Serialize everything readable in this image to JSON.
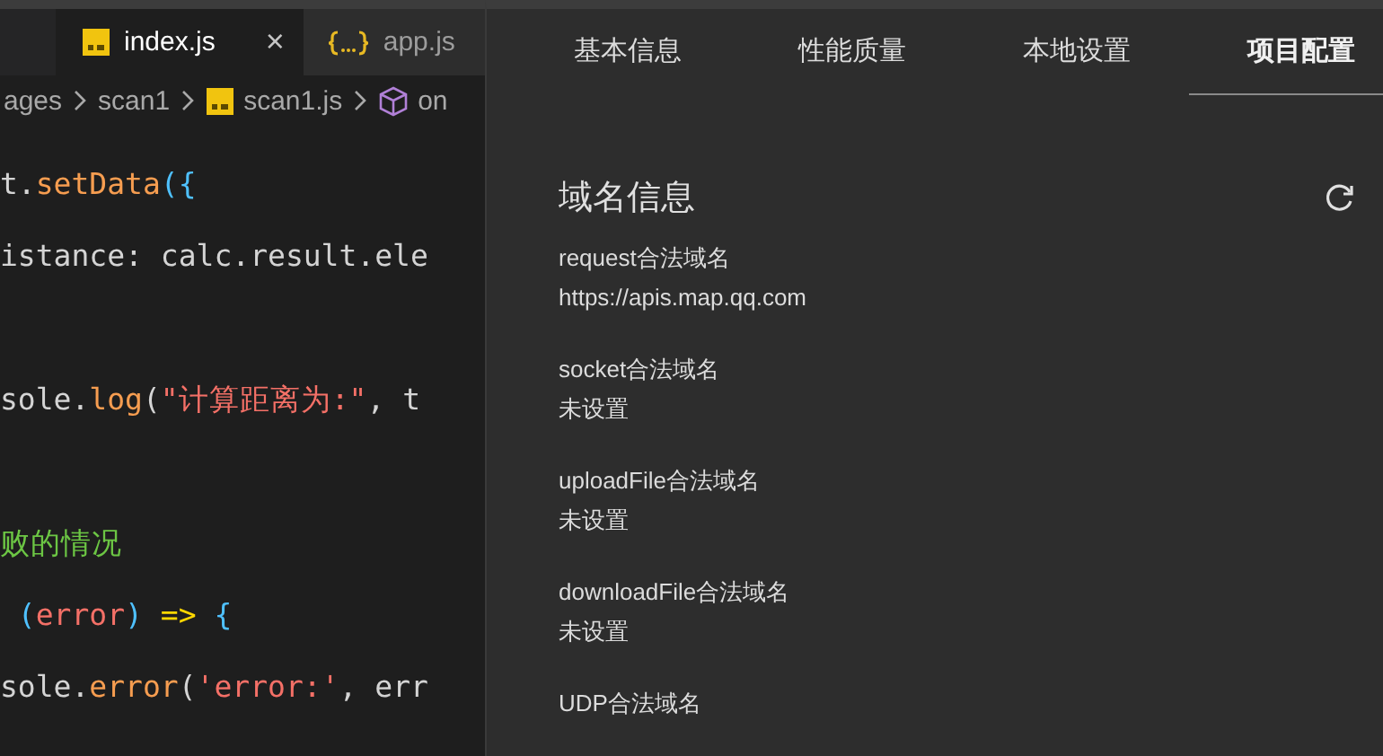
{
  "editor": {
    "tabs": [
      {
        "label": "index.js",
        "kind": "js",
        "selected": true,
        "close": "×"
      },
      {
        "label": "app.js",
        "kind": "json",
        "selected": false
      }
    ],
    "breadcrumb": [
      {
        "label": "ages"
      },
      {
        "label": "scan1"
      },
      {
        "label": "scan1.js",
        "kind": "js"
      },
      {
        "label": "on",
        "kind": "cube"
      }
    ],
    "lines": [
      {
        "kind": "code",
        "tokens": [
          {
            "kind": "plain",
            "text": "t."
          },
          {
            "kind": "method",
            "text": "setData"
          },
          {
            "kind": "brace",
            "text": "({"
          }
        ]
      },
      {
        "kind": "code",
        "tokens": [
          {
            "kind": "plain",
            "text": "istance: calc.result.ele"
          }
        ]
      },
      {
        "kind": "blank"
      },
      {
        "kind": "code",
        "tokens": [
          {
            "kind": "plain",
            "text": "sole."
          },
          {
            "kind": "method",
            "text": "log"
          },
          {
            "kind": "paren",
            "text": "("
          },
          {
            "kind": "string",
            "text": "\"计算距离为:\""
          },
          {
            "kind": "plain",
            "text": ", t"
          }
        ]
      },
      {
        "kind": "blank"
      },
      {
        "kind": "code",
        "tokens": [
          {
            "kind": "comment",
            "text": "败的情况"
          }
        ]
      },
      {
        "kind": "code",
        "tokens": [
          {
            "kind": "brace",
            "text": " ("
          },
          {
            "kind": "param",
            "text": "error"
          },
          {
            "kind": "brace",
            "text": ")"
          },
          {
            "kind": "arrow",
            "text": " => "
          },
          {
            "kind": "brace",
            "text": "{"
          }
        ]
      },
      {
        "kind": "code",
        "tokens": [
          {
            "kind": "plain",
            "text": "sole."
          },
          {
            "kind": "method",
            "text": "error"
          },
          {
            "kind": "paren",
            "text": "("
          },
          {
            "kind": "string",
            "text": "'error:'"
          },
          {
            "kind": "plain",
            "text": ", err"
          }
        ]
      }
    ]
  },
  "panel": {
    "tabs": [
      {
        "label": "基本信息",
        "selected": false
      },
      {
        "label": "性能质量",
        "selected": false
      },
      {
        "label": "本地设置",
        "selected": false
      },
      {
        "label": "项目配置",
        "selected": true
      }
    ],
    "section_title": "域名信息",
    "items": [
      {
        "label": "request合法域名",
        "value": "https://apis.map.qq.com"
      },
      {
        "label": "socket合法域名",
        "value": "未设置"
      },
      {
        "label": "uploadFile合法域名",
        "value": "未设置"
      },
      {
        "label": "downloadFile合法域名",
        "value": "未设置"
      },
      {
        "label": "UDP合法域名"
      }
    ]
  }
}
